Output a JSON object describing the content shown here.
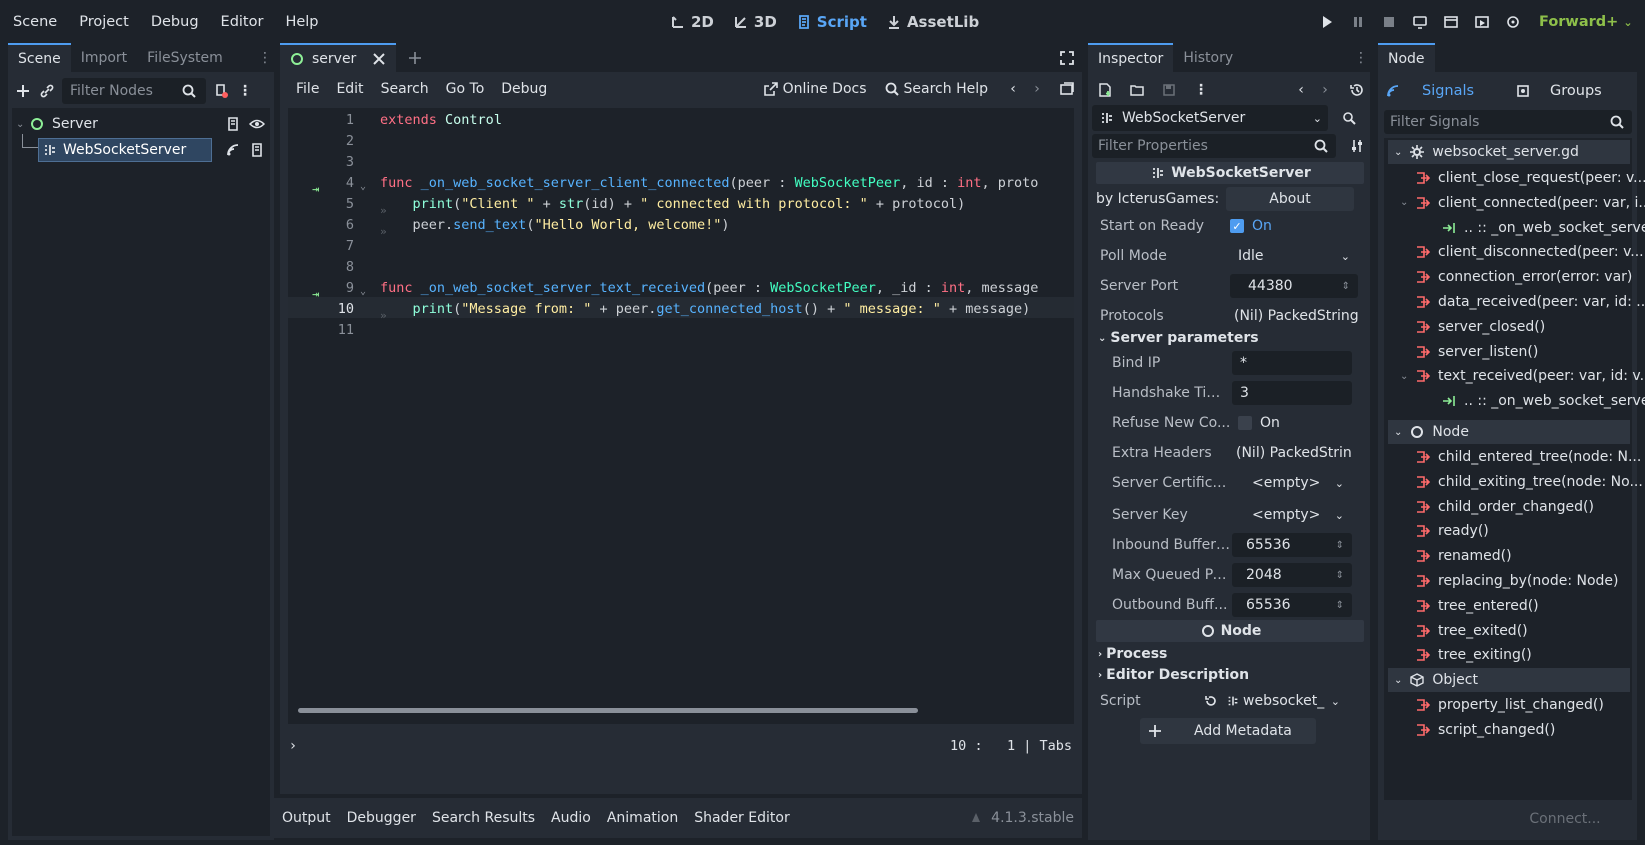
{
  "menu": [
    "Scene",
    "Project",
    "Debug",
    "Editor",
    "Help"
  ],
  "modes": [
    {
      "label": "2D",
      "icon": "2d-icon"
    },
    {
      "label": "3D",
      "icon": "3d-icon"
    },
    {
      "label": "Script",
      "icon": "script-icon"
    },
    {
      "label": "AssetLib",
      "icon": "assetlib-icon"
    }
  ],
  "renderer": "Forward+",
  "scene_dock": {
    "tabs": [
      "Scene",
      "Import",
      "FileSystem"
    ],
    "filter_placeholder": "Filter Nodes",
    "tree": [
      "Server",
      "WebSocketServer"
    ]
  },
  "script_editor": {
    "tab": "server",
    "menu": [
      "File",
      "Edit",
      "Search",
      "Go To",
      "Debug"
    ],
    "online_docs": "Online Docs",
    "search_help": "Search Help",
    "status": {
      "line": "10",
      "col": "1",
      "indent": "Tabs"
    }
  },
  "code_lines": [
    {
      "n": "1",
      "html": "<span class='kw'>extends</span> <span class='cls'>Control</span>"
    },
    {
      "n": "2",
      "html": ""
    },
    {
      "n": "3",
      "html": ""
    },
    {
      "n": "4",
      "html": "<span class='kw'>func</span> <span class='fn'>_on_web_socket_server_client_connected</span>(peer : <span class='ty'>WebSocketPeer</span>, id : <span class='kw'>int</span>, proto"
    },
    {
      "n": "5",
      "html": "    <span class='bi'>print</span>(<span class='st'>\"Client \"</span> + <span class='bi'>str</span>(id) + <span class='st'>\" connected with protocol: \"</span> + protocol)"
    },
    {
      "n": "6",
      "html": "    peer.<span class='fn'>send_text</span>(<span class='st'>\"Hello World, welcome!\"</span>)"
    },
    {
      "n": "7",
      "html": ""
    },
    {
      "n": "8",
      "html": ""
    },
    {
      "n": "9",
      "html": "<span class='kw'>func</span> <span class='fn'>_on_web_socket_server_text_received</span>(peer : <span class='ty'>WebSocketPeer</span>, _id : <span class='kw'>int</span>, message"
    },
    {
      "n": "10",
      "html": "    <span class='bi'>print</span>(<span class='st'>\"Message from: \"</span> + peer.<span class='fn'>get_connected_host</span>() + <span class='st'>\" message: \"</span> + message)"
    },
    {
      "n": "11",
      "html": ""
    }
  ],
  "bottom_tabs": [
    "Output",
    "Debugger",
    "Search Results",
    "Audio",
    "Animation",
    "Shader Editor"
  ],
  "version": "4.1.3.stable",
  "inspector": {
    "tabs": [
      "Inspector",
      "History"
    ],
    "node": "WebSocketServer",
    "filter_placeholder": "Filter Properties",
    "section": "WebSocketServer",
    "by": "by IcterusGames:",
    "about": "About",
    "props": [
      {
        "label": "Start on Ready",
        "value": "On"
      },
      {
        "label": "Poll Mode",
        "value": "Idle"
      },
      {
        "label": "Server Port",
        "value": "44380"
      },
      {
        "label": "Protocols",
        "value": "(Nil) PackedString"
      }
    ],
    "group": "Server parameters",
    "subprops": [
      {
        "label": "Bind IP",
        "value": "*"
      },
      {
        "label": "Handshake Tim...",
        "value": "3"
      },
      {
        "label": "Refuse New Co...",
        "value": "On"
      },
      {
        "label": "Extra Headers",
        "value": "(Nil) PackedStrin"
      },
      {
        "label": "Server Certificate",
        "value": "<empty>"
      },
      {
        "label": "Server Key",
        "value": "<empty>"
      },
      {
        "label": "Inbound Buffer ...",
        "value": "65536"
      },
      {
        "label": "Max Queued Pa...",
        "value": "2048"
      },
      {
        "label": "Outbound Buff...",
        "value": "65536"
      }
    ],
    "node_section": "Node",
    "process": "Process",
    "editor_desc": "Editor Description",
    "script_label": "Script",
    "script_value": "websocket_",
    "add_metadata": "Add Metadata"
  },
  "node_dock": {
    "tab": "Node",
    "signals": "Signals",
    "groups": "Groups",
    "filter_placeholder": "Filter Signals",
    "script_header": "websocket_server.gd",
    "script_signals": [
      {
        "name": "client_close_request(peer: v...",
        "child": false
      },
      {
        "name": "client_connected(peer: var, i...",
        "child": false,
        "open": true
      },
      {
        "name": ".. :: _on_web_socket_serve...",
        "child": true
      },
      {
        "name": "client_disconnected(peer: v...",
        "child": false
      },
      {
        "name": "connection_error(error: var)",
        "child": false
      },
      {
        "name": "data_received(peer: var, id: ...",
        "child": false
      },
      {
        "name": "server_closed()",
        "child": false
      },
      {
        "name": "server_listen()",
        "child": false
      },
      {
        "name": "text_received(peer: var, id: v...",
        "child": false,
        "open": true
      },
      {
        "name": ".. :: _on_web_socket_serve...",
        "child": true
      }
    ],
    "node_header": "Node",
    "node_signals": [
      "child_entered_tree(node: N...",
      "child_exiting_tree(node: No...",
      "child_order_changed()",
      "ready()",
      "renamed()",
      "replacing_by(node: Node)",
      "tree_entered()",
      "tree_exited()",
      "tree_exiting()"
    ],
    "object_header": "Object",
    "object_signals": [
      "property_list_changed()",
      "script_changed()"
    ],
    "connect": "Connect..."
  }
}
